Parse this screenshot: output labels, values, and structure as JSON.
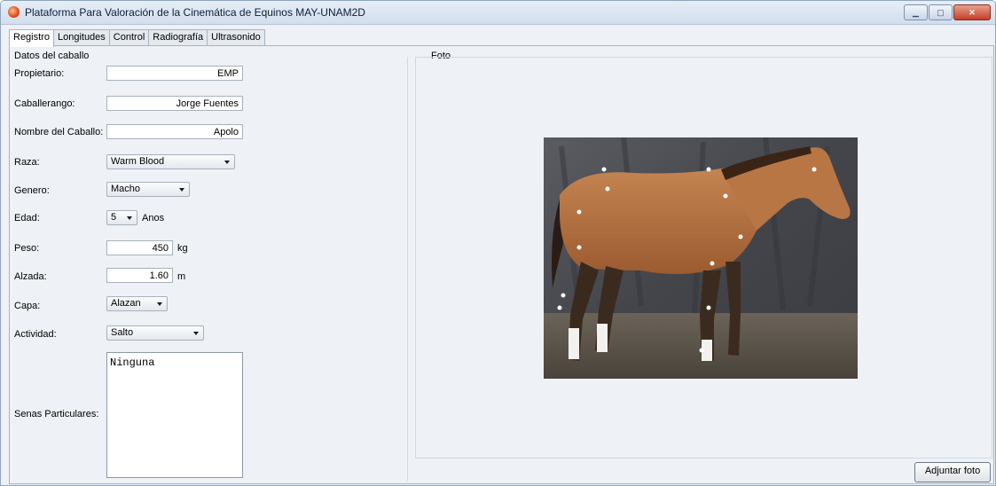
{
  "window": {
    "title": "Plataforma Para Valoración de la Cinemática de Equinos MAY-UNAM2D",
    "controls": [
      "minimize",
      "maximize",
      "close"
    ]
  },
  "tabs": [
    {
      "label": "Registro",
      "active": true
    },
    {
      "label": "Longitudes",
      "active": false
    },
    {
      "label": "Control",
      "active": false
    },
    {
      "label": "Radiografía",
      "active": false
    },
    {
      "label": "Ultrasonido",
      "active": false
    }
  ],
  "form": {
    "section_title": "Datos del caballo",
    "propietario": {
      "label": "Propietario:",
      "value": "EMP"
    },
    "caballerango": {
      "label": "Caballerango:",
      "value": "Jorge Fuentes"
    },
    "nombre": {
      "label": "Nombre del Caballo:",
      "value": "Apolo"
    },
    "raza": {
      "label": "Raza:",
      "value": "Warm Blood"
    },
    "genero": {
      "label": "Genero:",
      "value": "Macho"
    },
    "edad": {
      "label": "Edad:",
      "value": "5",
      "unit": "Anos"
    },
    "peso": {
      "label": "Peso:",
      "value": "450",
      "unit": "kg"
    },
    "alzada": {
      "label": "Alzada:",
      "value": "1.60",
      "unit": "m"
    },
    "capa": {
      "label": "Capa:",
      "value": "Alazan"
    },
    "actividad": {
      "label": "Actividad:",
      "value": "Salto"
    },
    "senas": {
      "label": "Senas Particulares:",
      "value": "Ninguna"
    }
  },
  "photo_panel": {
    "title": "Foto",
    "image_alt": "horse photo with marker dots",
    "attach_button": "Adjuntar foto"
  }
}
